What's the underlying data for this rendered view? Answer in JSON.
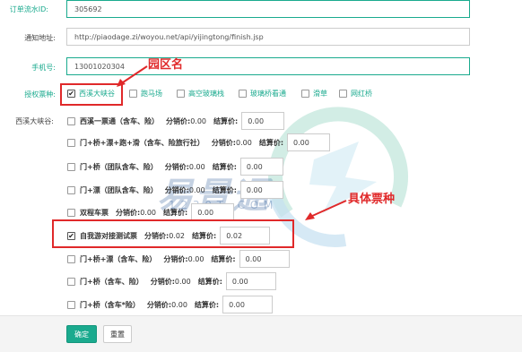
{
  "form": {
    "order_id": {
      "label": "订单流水ID:",
      "value": "305692"
    },
    "notify_url": {
      "label": "通知地址:",
      "value": "http://piaodage.zi/woyou.net/api/yijingtong/finish.jsp"
    },
    "phone": {
      "label": "手机号:",
      "value": "13001020304"
    },
    "auth_label": "授权票种:",
    "park_label": "西溪大峡谷:"
  },
  "venues": [
    {
      "label": "西溪大峡谷",
      "checked": true
    },
    {
      "label": "跑马场",
      "checked": false
    },
    {
      "label": "高空玻璃栈",
      "checked": false
    },
    {
      "label": "玻璃桥看通",
      "checked": false
    },
    {
      "label": "滑草",
      "checked": false
    },
    {
      "label": "网红桥",
      "checked": false
    }
  ],
  "ticket_common": {
    "dist_label": "分销价:",
    "settle_label": "结算价:"
  },
  "tickets": [
    {
      "name": "西溪一票通（含车、险）",
      "dist": "0.00",
      "settle": "0.00",
      "checked": false
    },
    {
      "name": "门+桥+漂+跑+滑（含车、险旅行社）",
      "dist": "0.00",
      "settle": "0.00",
      "checked": false
    },
    {
      "name": "门+桥（团队含车、险）",
      "dist": "0.00",
      "settle": "0.00",
      "checked": false
    },
    {
      "name": "门+漂（团队含车、险）",
      "dist": "0.00",
      "settle": "0.00",
      "checked": false
    },
    {
      "name": "双程车票",
      "dist": "0.00",
      "settle": "0.00",
      "checked": false
    },
    {
      "name": "自我游对接测试票",
      "dist": "0.02",
      "settle": "0.02",
      "checked": true
    },
    {
      "name": "门+桥+漂（含车、险）",
      "dist": "0.00",
      "settle": "0.00",
      "checked": false
    },
    {
      "name": "门+桥（含车、险）",
      "dist": "0.00",
      "settle": "0.00",
      "checked": false
    },
    {
      "name": "门+桥（含车*险）",
      "dist": "0.00",
      "settle": "0.00",
      "checked": false
    }
  ],
  "annotations": {
    "park_name": "园区名",
    "ticket_type": "具体票种"
  },
  "watermark": {
    "brand": "易景通",
    "url": "1 2 3 0 T . C O M"
  },
  "buttons": {
    "confirm": "确定",
    "reset": "重置"
  },
  "colors": {
    "accent": "#1aaa8e",
    "annotation": "#e0292a"
  }
}
